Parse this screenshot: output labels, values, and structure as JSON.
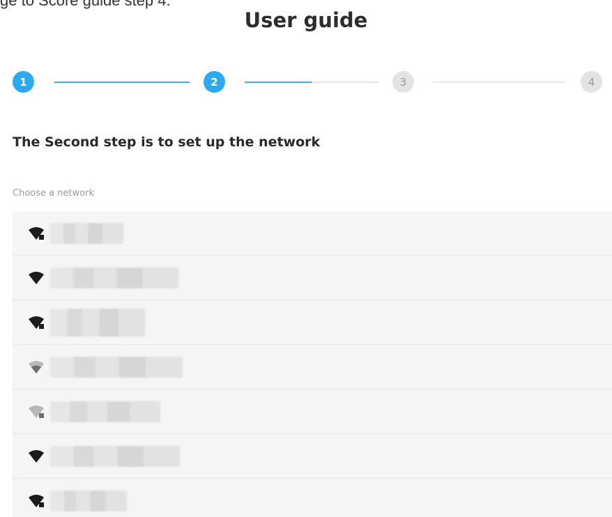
{
  "caption": "ge to Score guide step 4.",
  "title": "User guide",
  "stepper": {
    "steps": [
      {
        "label": "1",
        "state": "active"
      },
      {
        "label": "2",
        "state": "active"
      },
      {
        "label": "3",
        "state": "inactive"
      },
      {
        "label": "4",
        "state": "inactive"
      }
    ],
    "progress_second_segment": 0.5,
    "colors": {
      "active": "#2aaaf3",
      "inactive": "#e3e3e3",
      "line": "#3cb0ee"
    }
  },
  "section_heading": "The Second step is to set up the network",
  "network_label": "Choose a network",
  "networks": [
    {
      "ssid": "",
      "icon": "wifi-secured-icon",
      "signal": "strong"
    },
    {
      "ssid": "",
      "icon": "wifi-icon",
      "signal": "strong"
    },
    {
      "ssid": "",
      "icon": "wifi-secured-icon",
      "signal": "strong"
    },
    {
      "ssid": "",
      "icon": "wifi-icon",
      "signal": "weak"
    },
    {
      "ssid": "",
      "icon": "wifi-secured-icon",
      "signal": "weak"
    },
    {
      "ssid": "",
      "icon": "wifi-icon",
      "signal": "strong"
    },
    {
      "ssid": "",
      "icon": "wifi-secured-icon",
      "signal": "strong"
    }
  ]
}
